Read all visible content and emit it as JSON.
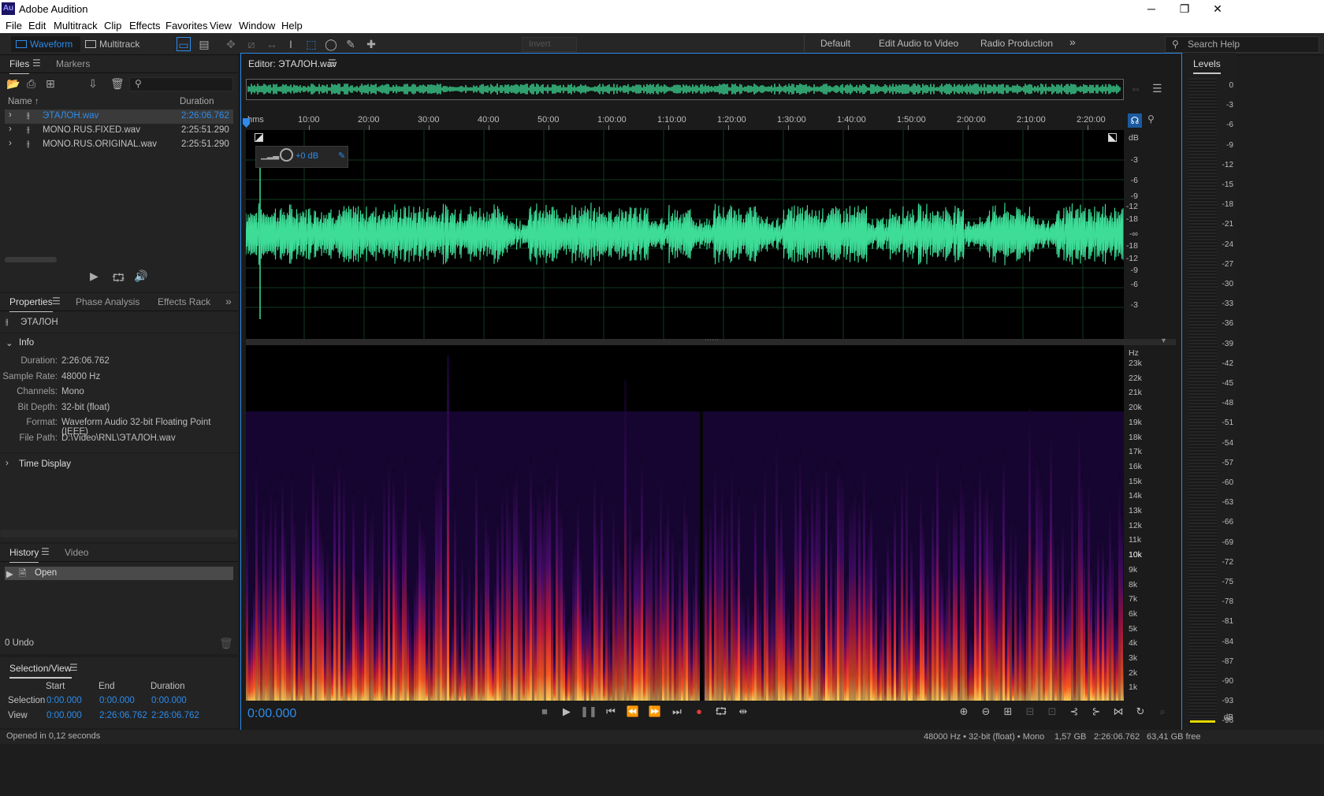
{
  "app": {
    "title": "Adobe Audition",
    "logo": "Au",
    "win_controls": [
      "─",
      "❐",
      "✕"
    ]
  },
  "menu": [
    "File",
    "Edit",
    "Multitrack",
    "Clip",
    "Effects",
    "Favorites",
    "View",
    "Window",
    "Help"
  ],
  "toolbar": {
    "waveform": "Waveform",
    "multitrack": "Multitrack",
    "invert": "Invert",
    "workspaces": [
      "Default",
      "Edit Audio to Video",
      "Radio Production"
    ],
    "more": "»",
    "search_placeholder": "Search Help"
  },
  "files_panel": {
    "tabs": [
      "Files",
      "Markers"
    ],
    "col_name": "Name",
    "col_duration": "Duration",
    "rows": [
      {
        "name": "ЭТАЛОН.wav",
        "duration": "2:26:06.762"
      },
      {
        "name": "MONO.RUS.FIXED.wav",
        "duration": "2:25:51.290"
      },
      {
        "name": "MONO.RUS.ORIGINAL.wav",
        "duration": "2:25:51.290"
      }
    ]
  },
  "properties": {
    "tabs": [
      "Properties",
      "Phase Analysis",
      "Effects Rack"
    ],
    "file": "ЭТАЛОН",
    "info_header": "Info",
    "info": [
      {
        "label": "Duration:",
        "value": "2:26:06.762"
      },
      {
        "label": "Sample Rate:",
        "value": "48000 Hz"
      },
      {
        "label": "Channels:",
        "value": "Mono"
      },
      {
        "label": "Bit Depth:",
        "value": "32-bit (float)"
      },
      {
        "label": "Format:",
        "value": "Waveform Audio 32-bit Floating Point (IEEE)"
      },
      {
        "label": "File Path:",
        "value": "D:\\Video\\RNL\\ЭТАЛОН.wav"
      }
    ],
    "time_display": "Time Display"
  },
  "history": {
    "tabs": [
      "History",
      "Video"
    ],
    "item": "Open",
    "undo": "0 Undo"
  },
  "selection_view": {
    "title": "Selection/View",
    "cols": [
      "Start",
      "End",
      "Duration"
    ],
    "rows": [
      {
        "label": "Selection",
        "start": "0:00.000",
        "end": "0:00.000",
        "duration": "0:00.000"
      },
      {
        "label": "View",
        "start": "0:00.000",
        "end": "2:26:06.762",
        "duration": "2:26:06.762"
      }
    ]
  },
  "editor": {
    "title": "Editor: ЭТАЛОН.wav",
    "ruler_unit": "hms",
    "ruler": [
      "10:00",
      "20:00",
      "30:00",
      "40:00",
      "50:00",
      "1:00:00",
      "1:10:00",
      "1:20:00",
      "1:30:00",
      "1:40:00",
      "1:50:00",
      "2:00:00",
      "2:10:00",
      "2:20:00"
    ],
    "gain": "+0 dB",
    "db_unit": "dB",
    "db_scale": [
      "-3",
      "-6",
      "-9",
      "-12",
      "-18",
      "-∞",
      "-18",
      "-12",
      "-9",
      "-6",
      "-3"
    ],
    "hz_unit": "Hz",
    "hz_scale": [
      "23k",
      "22k",
      "21k",
      "20k",
      "19k",
      "18k",
      "17k",
      "16k",
      "15k",
      "14k",
      "13k",
      "12k",
      "11k",
      "10k",
      "9k",
      "8k",
      "7k",
      "6k",
      "5k",
      "4k",
      "3k",
      "2k",
      "1k"
    ],
    "current_time": "0:00.000",
    "waveform_color": "#3ddc97"
  },
  "levels": {
    "title": "Levels",
    "scale": [
      "0",
      "-3",
      "-6",
      "-9",
      "-12",
      "-15",
      "-18",
      "-21",
      "-24",
      "-27",
      "-30",
      "-33",
      "-36",
      "-39",
      "-42",
      "-45",
      "-48",
      "-51",
      "-54",
      "-57",
      "-60",
      "-63",
      "-66",
      "-69",
      "-72",
      "-75",
      "-78",
      "-81",
      "-84",
      "-87",
      "-90",
      "-93",
      "-96"
    ],
    "unit": "dB"
  },
  "status": {
    "left": "Opened in 0,12 seconds",
    "format": "48000 Hz • 32-bit (float) • Mono",
    "size": "1,57 GB",
    "duration": "2:26:06.762",
    "free": "63,41 GB free"
  },
  "colors": {
    "accent": "#2d8ceb",
    "waveform": "#3ddc97",
    "record": "#e23b3b"
  }
}
